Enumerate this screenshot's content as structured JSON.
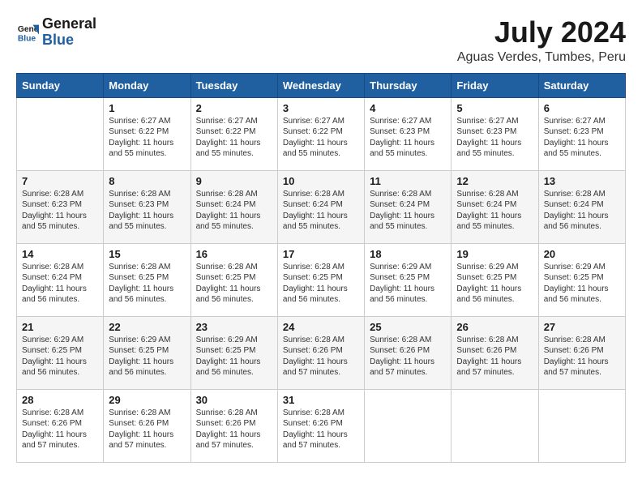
{
  "header": {
    "logo_general": "General",
    "logo_blue": "Blue",
    "month_title": "July 2024",
    "location": "Aguas Verdes, Tumbes, Peru"
  },
  "weekdays": [
    "Sunday",
    "Monday",
    "Tuesday",
    "Wednesday",
    "Thursday",
    "Friday",
    "Saturday"
  ],
  "weeks": [
    [
      {
        "day": "",
        "info": ""
      },
      {
        "day": "1",
        "info": "Sunrise: 6:27 AM\nSunset: 6:22 PM\nDaylight: 11 hours\nand 55 minutes."
      },
      {
        "day": "2",
        "info": "Sunrise: 6:27 AM\nSunset: 6:22 PM\nDaylight: 11 hours\nand 55 minutes."
      },
      {
        "day": "3",
        "info": "Sunrise: 6:27 AM\nSunset: 6:22 PM\nDaylight: 11 hours\nand 55 minutes."
      },
      {
        "day": "4",
        "info": "Sunrise: 6:27 AM\nSunset: 6:23 PM\nDaylight: 11 hours\nand 55 minutes."
      },
      {
        "day": "5",
        "info": "Sunrise: 6:27 AM\nSunset: 6:23 PM\nDaylight: 11 hours\nand 55 minutes."
      },
      {
        "day": "6",
        "info": "Sunrise: 6:27 AM\nSunset: 6:23 PM\nDaylight: 11 hours\nand 55 minutes."
      }
    ],
    [
      {
        "day": "7",
        "info": "Sunrise: 6:28 AM\nSunset: 6:23 PM\nDaylight: 11 hours\nand 55 minutes."
      },
      {
        "day": "8",
        "info": "Sunrise: 6:28 AM\nSunset: 6:23 PM\nDaylight: 11 hours\nand 55 minutes."
      },
      {
        "day": "9",
        "info": "Sunrise: 6:28 AM\nSunset: 6:24 PM\nDaylight: 11 hours\nand 55 minutes."
      },
      {
        "day": "10",
        "info": "Sunrise: 6:28 AM\nSunset: 6:24 PM\nDaylight: 11 hours\nand 55 minutes."
      },
      {
        "day": "11",
        "info": "Sunrise: 6:28 AM\nSunset: 6:24 PM\nDaylight: 11 hours\nand 55 minutes."
      },
      {
        "day": "12",
        "info": "Sunrise: 6:28 AM\nSunset: 6:24 PM\nDaylight: 11 hours\nand 55 minutes."
      },
      {
        "day": "13",
        "info": "Sunrise: 6:28 AM\nSunset: 6:24 PM\nDaylight: 11 hours\nand 56 minutes."
      }
    ],
    [
      {
        "day": "14",
        "info": "Sunrise: 6:28 AM\nSunset: 6:24 PM\nDaylight: 11 hours\nand 56 minutes."
      },
      {
        "day": "15",
        "info": "Sunrise: 6:28 AM\nSunset: 6:25 PM\nDaylight: 11 hours\nand 56 minutes."
      },
      {
        "day": "16",
        "info": "Sunrise: 6:28 AM\nSunset: 6:25 PM\nDaylight: 11 hours\nand 56 minutes."
      },
      {
        "day": "17",
        "info": "Sunrise: 6:28 AM\nSunset: 6:25 PM\nDaylight: 11 hours\nand 56 minutes."
      },
      {
        "day": "18",
        "info": "Sunrise: 6:29 AM\nSunset: 6:25 PM\nDaylight: 11 hours\nand 56 minutes."
      },
      {
        "day": "19",
        "info": "Sunrise: 6:29 AM\nSunset: 6:25 PM\nDaylight: 11 hours\nand 56 minutes."
      },
      {
        "day": "20",
        "info": "Sunrise: 6:29 AM\nSunset: 6:25 PM\nDaylight: 11 hours\nand 56 minutes."
      }
    ],
    [
      {
        "day": "21",
        "info": "Sunrise: 6:29 AM\nSunset: 6:25 PM\nDaylight: 11 hours\nand 56 minutes."
      },
      {
        "day": "22",
        "info": "Sunrise: 6:29 AM\nSunset: 6:25 PM\nDaylight: 11 hours\nand 56 minutes."
      },
      {
        "day": "23",
        "info": "Sunrise: 6:29 AM\nSunset: 6:25 PM\nDaylight: 11 hours\nand 56 minutes."
      },
      {
        "day": "24",
        "info": "Sunrise: 6:28 AM\nSunset: 6:26 PM\nDaylight: 11 hours\nand 57 minutes."
      },
      {
        "day": "25",
        "info": "Sunrise: 6:28 AM\nSunset: 6:26 PM\nDaylight: 11 hours\nand 57 minutes."
      },
      {
        "day": "26",
        "info": "Sunrise: 6:28 AM\nSunset: 6:26 PM\nDaylight: 11 hours\nand 57 minutes."
      },
      {
        "day": "27",
        "info": "Sunrise: 6:28 AM\nSunset: 6:26 PM\nDaylight: 11 hours\nand 57 minutes."
      }
    ],
    [
      {
        "day": "28",
        "info": "Sunrise: 6:28 AM\nSunset: 6:26 PM\nDaylight: 11 hours\nand 57 minutes."
      },
      {
        "day": "29",
        "info": "Sunrise: 6:28 AM\nSunset: 6:26 PM\nDaylight: 11 hours\nand 57 minutes."
      },
      {
        "day": "30",
        "info": "Sunrise: 6:28 AM\nSunset: 6:26 PM\nDaylight: 11 hours\nand 57 minutes."
      },
      {
        "day": "31",
        "info": "Sunrise: 6:28 AM\nSunset: 6:26 PM\nDaylight: 11 hours\nand 57 minutes."
      },
      {
        "day": "",
        "info": ""
      },
      {
        "day": "",
        "info": ""
      },
      {
        "day": "",
        "info": ""
      }
    ]
  ]
}
